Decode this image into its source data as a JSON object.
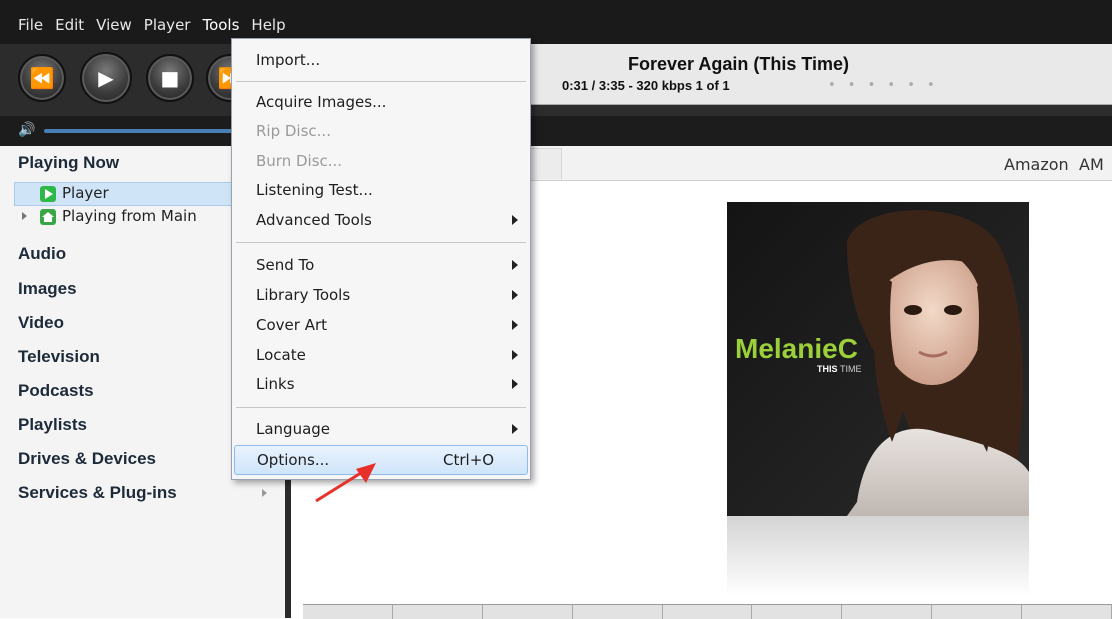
{
  "menubar": {
    "items": [
      "File",
      "Edit",
      "View",
      "Player",
      "Tools",
      "Help"
    ]
  },
  "now_playing": {
    "title": "Forever Again (This Time)",
    "info": "0:31 / 3:35 - 320 kbps   1 of 1",
    "dots": "• • • • • •"
  },
  "sidebar": {
    "playing_now": "Playing Now",
    "player": "Player",
    "playing_from": "Playing from Main",
    "sections": [
      "Audio",
      "Images",
      "Video",
      "Television",
      "Podcasts",
      "Playlists",
      "Drives & Devices",
      "Services & Plug-ins"
    ]
  },
  "content": {
    "amazon_link": "Amazon",
    "am_partial": "AM",
    "album": {
      "artist_text": "MelanieC",
      "title_text": "THIS",
      "title_text2": "TIME"
    }
  },
  "tools_menu": {
    "items": [
      {
        "label": "Import...",
        "disabled": false
      },
      {
        "label": "Acquire Images...",
        "disabled": false
      },
      {
        "label": "Rip Disc...",
        "disabled": true
      },
      {
        "label": "Burn Disc...",
        "disabled": true
      },
      {
        "label": "Listening Test...",
        "disabled": false
      },
      {
        "label": "Advanced Tools",
        "disabled": false,
        "submenu": true
      },
      {
        "label": "Send To",
        "disabled": false,
        "submenu": true
      },
      {
        "label": "Library Tools",
        "disabled": false,
        "submenu": true
      },
      {
        "label": "Cover Art",
        "disabled": false,
        "submenu": true
      },
      {
        "label": "Locate",
        "disabled": false,
        "submenu": true
      },
      {
        "label": "Links",
        "disabled": false,
        "submenu": true
      },
      {
        "label": "Language",
        "disabled": false,
        "submenu": true
      },
      {
        "label": "Options...",
        "disabled": false,
        "shortcut": "Ctrl+O",
        "highlighted": true
      }
    ]
  },
  "colors": {
    "accent": "#4a7fb5",
    "annotation_arrow": "#e8302a",
    "menu_highlight": "#cfe5fa"
  }
}
